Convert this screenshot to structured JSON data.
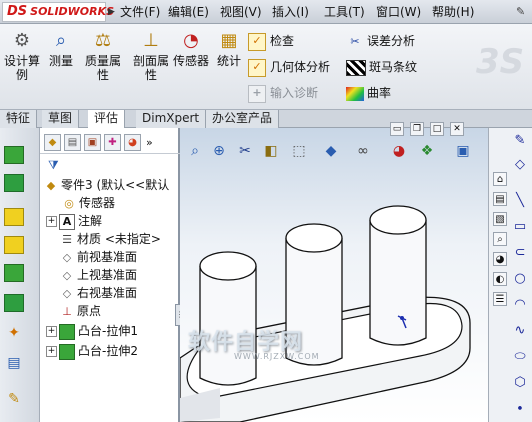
{
  "app": {
    "logo": "SOLIDWORKS",
    "logo_mark": "DS"
  },
  "menu": {
    "items": [
      "文件(F)",
      "编辑(E)",
      "视图(V)",
      "插入(I)",
      "工具(T)",
      "窗口(W)",
      "帮助(H)"
    ]
  },
  "commands": {
    "design_study": "设计算例",
    "measure": "测量",
    "mass_props": "质量属性",
    "section_props": "剖面属性",
    "sensor": "传感器",
    "statistics": "统计",
    "check": "检查",
    "geometry_analysis": "几何体分析",
    "import_diagnostics": "输入诊断",
    "deviation_analysis": "误差分析",
    "zebra": "斑马条纹",
    "curvature": "曲率"
  },
  "tabs": [
    "特征",
    "草图",
    "评估",
    "DimXpert",
    "办公室产品"
  ],
  "active_tab": "评估",
  "tree": {
    "root": "零件3 (默认<<默认",
    "items": [
      {
        "label": "传感器",
        "icon": "sensor-icon"
      },
      {
        "label": "注解",
        "icon": "annotation-icon"
      },
      {
        "label": "材质 <未指定>",
        "icon": "material-icon"
      },
      {
        "label": "前视基准面",
        "icon": "plane-icon"
      },
      {
        "label": "上视基准面",
        "icon": "plane-icon"
      },
      {
        "label": "右视基准面",
        "icon": "plane-icon"
      },
      {
        "label": "原点",
        "icon": "origin-icon"
      },
      {
        "label": "凸台-拉伸1",
        "icon": "extrude-icon"
      },
      {
        "label": "凸台-拉伸2",
        "icon": "extrude-icon"
      }
    ]
  },
  "watermark": {
    "text": "软件自学网",
    "sub": "WWW.RJZXW.COM"
  },
  "colors": {
    "menu_red": "#d01818",
    "accent_yellow": "#f0c020",
    "model_face": "#ffffff"
  }
}
